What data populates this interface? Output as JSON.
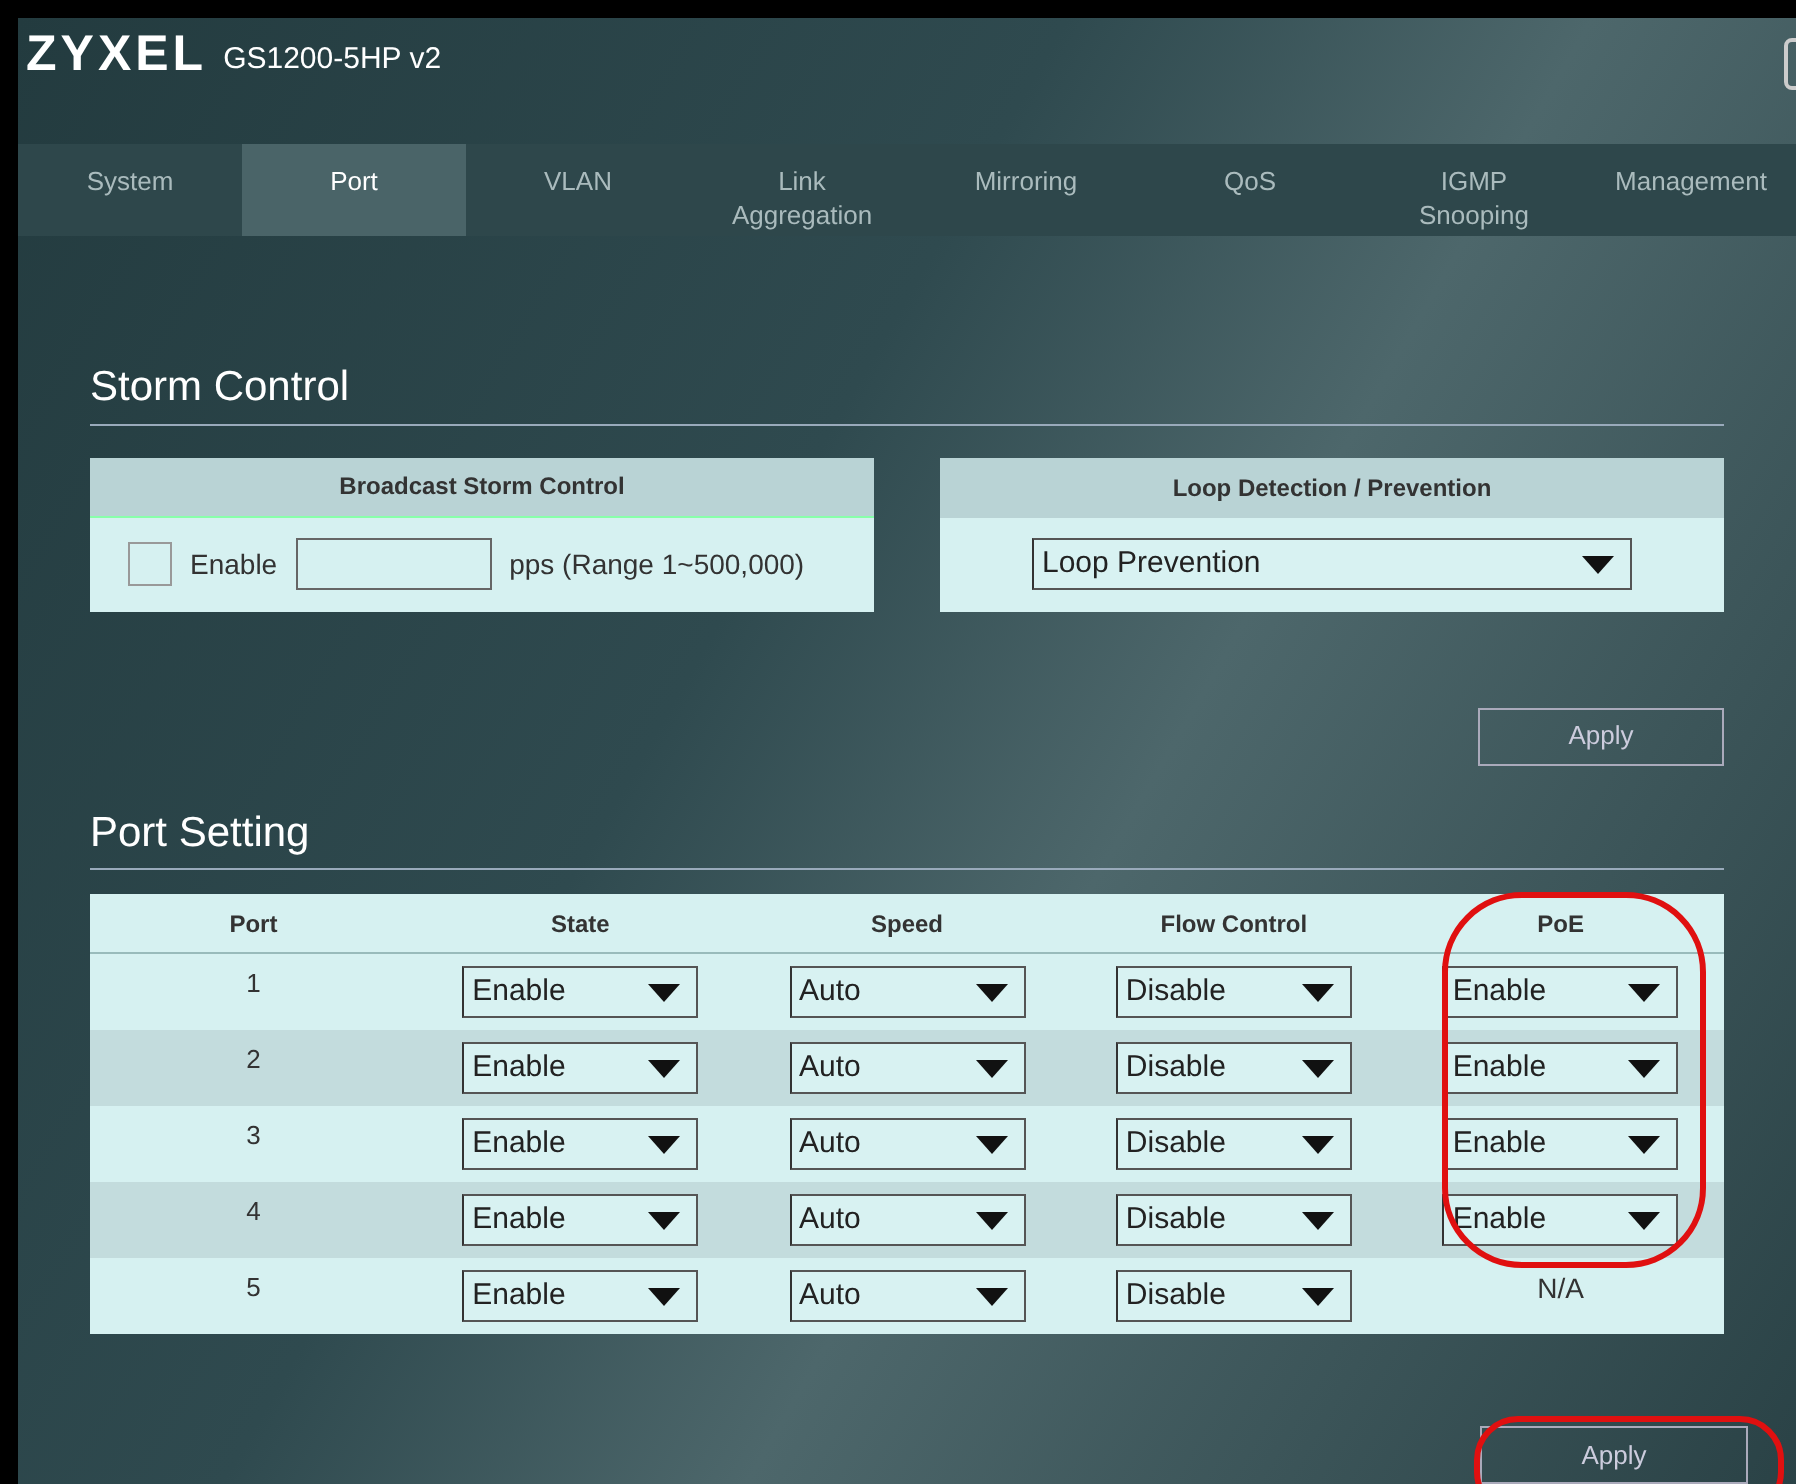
{
  "header": {
    "logo": "ZYXEL",
    "model": "GS1200-5HP v2"
  },
  "tabs": [
    {
      "label": "System",
      "selected": false
    },
    {
      "label": "Port",
      "selected": true
    },
    {
      "label": "VLAN",
      "selected": false
    },
    {
      "label": "Link Aggregation",
      "selected": false
    },
    {
      "label": "Mirroring",
      "selected": false
    },
    {
      "label": "QoS",
      "selected": false
    },
    {
      "label": "IGMP Snooping",
      "selected": false
    },
    {
      "label": "Management",
      "selected": false
    }
  ],
  "storm_control": {
    "title": "Storm Control",
    "broadcast": {
      "heading": "Broadcast Storm Control",
      "checked": false,
      "label": "Enable",
      "unit": "pps (Range 1~500,000)"
    },
    "loop": {
      "heading": "Loop Detection / Prevention",
      "value": "Loop Prevention"
    },
    "apply": "Apply"
  },
  "port_setting": {
    "title": "Port Setting",
    "columns": [
      "Port",
      "State",
      "Speed",
      "Flow Control",
      "PoE"
    ],
    "rows": [
      {
        "port": "1",
        "state": "Enable",
        "speed": "Auto",
        "flow": "Disable",
        "poe": {
          "kind": "select",
          "value": "Enable"
        }
      },
      {
        "port": "2",
        "state": "Enable",
        "speed": "Auto",
        "flow": "Disable",
        "poe": {
          "kind": "select",
          "value": "Enable"
        }
      },
      {
        "port": "3",
        "state": "Enable",
        "speed": "Auto",
        "flow": "Disable",
        "poe": {
          "kind": "select",
          "value": "Enable"
        }
      },
      {
        "port": "4",
        "state": "Enable",
        "speed": "Auto",
        "flow": "Disable",
        "poe": {
          "kind": "select",
          "value": "Enable"
        }
      },
      {
        "port": "5",
        "state": "Enable",
        "speed": "Auto",
        "flow": "Disable",
        "poe": {
          "kind": "text",
          "value": "N/A"
        }
      }
    ],
    "apply": "Apply"
  }
}
